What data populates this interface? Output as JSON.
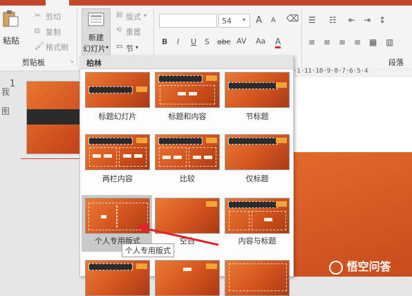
{
  "ribbon": {
    "clipboard": {
      "paste_label": "粘贴",
      "cut_label": "剪切",
      "copy_label": "复制",
      "format_painter_label": "格式刷",
      "group_label": "剪贴板"
    },
    "slides": {
      "new_slide_line1": "新建",
      "new_slide_line2": "幻灯片",
      "layout_label": "版式",
      "reset_label": "重置",
      "section_label": "节"
    },
    "font": {
      "font_size_value": "54",
      "bold": "B",
      "italic": "I",
      "underline": "U",
      "strikethrough": "S",
      "char_spacing": "abc",
      "grow": "A",
      "shrink": "A",
      "font_color": "A"
    },
    "paragraph": {
      "group_label": "段落"
    }
  },
  "left_pane": {
    "slide_number": "1",
    "side_text_1": "我",
    "side_text_2": "图"
  },
  "ruler": {
    "text": "·1·11·10·9·8·7·6·5·4"
  },
  "gallery": {
    "theme_name": "柏林",
    "layouts": [
      {
        "name": "标题幻灯片"
      },
      {
        "name": "标题和内容"
      },
      {
        "name": "节标题"
      },
      {
        "name": "两栏内容"
      },
      {
        "name": "比较"
      },
      {
        "name": "仅标题"
      },
      {
        "name": "个人专用版式"
      },
      {
        "name": "空白"
      },
      {
        "name": "内容与标题"
      }
    ],
    "selected_index": 6,
    "tooltip": "个人专用版式"
  },
  "watermark": {
    "text": "悟空问答"
  },
  "colors": {
    "accent": "#c4462a",
    "slide_orange": "#e26a2c",
    "arrow_red": "#e0242c"
  }
}
